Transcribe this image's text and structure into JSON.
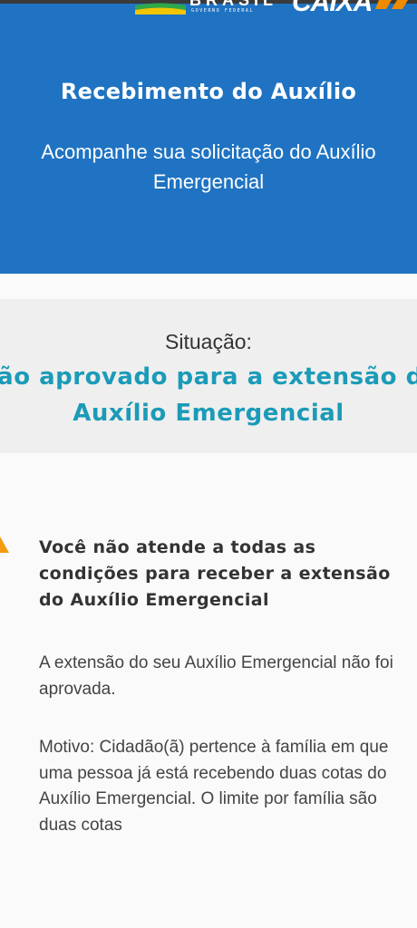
{
  "top_bar": {
    "brasil_logo_text": "BRASIL",
    "brasil_logo_subtext": "GOVERNO FEDERAL",
    "caixa_logo_text": "CAIXA"
  },
  "header": {
    "title": "Recebimento do Auxílio",
    "subtitle": "Acompanhe sua solicitação do Auxílio Emergencial"
  },
  "status": {
    "label": "Situação:",
    "value": "Não aprovado para a extensão do Auxílio Emergencial"
  },
  "warning": {
    "icon": "warning-triangle-icon",
    "title": "Você não atende a todas as condições para receber a extensão do Auxílio Emergencial",
    "paragraph_1": "A extensão do seu Auxílio Emergencial não foi aprovada.",
    "paragraph_2": "Motivo: Cidadão(ã) pertence à família em que uma pessoa já está recebendo duas cotas do Auxílio Emergencial. O limite por família são duas cotas"
  },
  "colors": {
    "header_blue": "#1f73c2",
    "status_teal": "#1b9bb8",
    "warning_orange": "#f39c12",
    "status_box_bg": "#efefef"
  }
}
